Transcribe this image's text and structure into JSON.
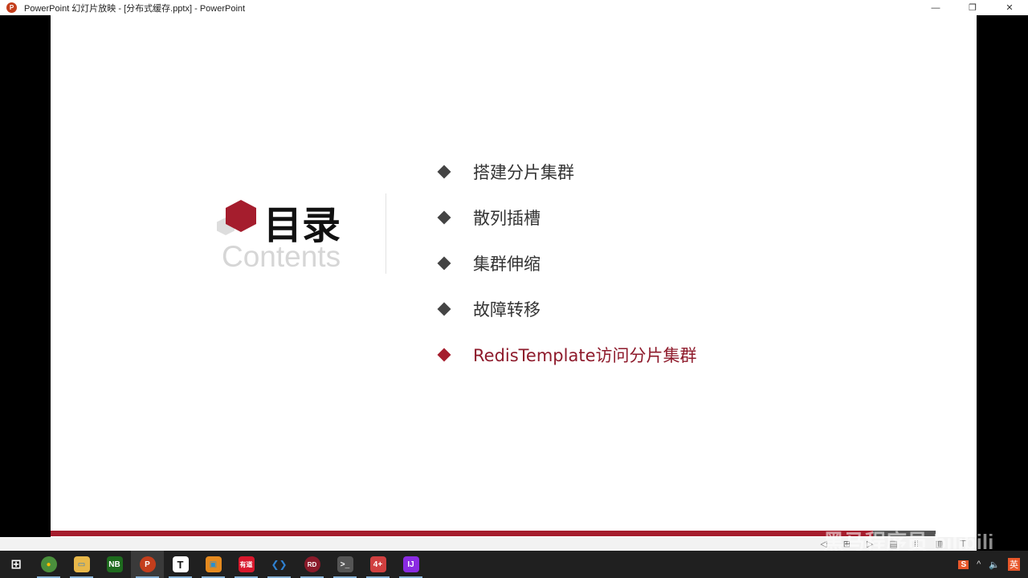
{
  "window": {
    "title": "PowerPoint 幻灯片放映 - [分布式缓存.pptx] - PowerPoint",
    "minimize": "—",
    "restore": "❐",
    "close": "✕"
  },
  "slide": {
    "title": "目录",
    "subtitle": "Contents",
    "items": [
      {
        "label": "搭建分片集群",
        "active": false
      },
      {
        "label": "散列插槽",
        "active": false
      },
      {
        "label": "集群伸缩",
        "active": false
      },
      {
        "label": "故障转移",
        "active": false
      },
      {
        "label": "RedisTemplate访问分片集群",
        "active": true
      }
    ],
    "accent": "#a51d2d"
  },
  "slideshow_toolbar": [
    "◁",
    "⊞",
    "▷",
    "▤",
    "⁞⁞",
    "▥",
    "⊤"
  ],
  "watermark": "黑马程序员 bilibili",
  "taskbar": {
    "apps": [
      {
        "name": "windows-start",
        "glyph": "⊞",
        "color": "transparent"
      },
      {
        "name": "chrome",
        "glyph": "●",
        "color": "#4a8f3c"
      },
      {
        "name": "file-explorer",
        "glyph": "▭",
        "color": "#e8b84a"
      },
      {
        "name": "notepad-nb",
        "glyph": "NB",
        "color": "#1e6b1e"
      },
      {
        "name": "powerpoint",
        "glyph": "P",
        "color": "#c43e1c"
      },
      {
        "name": "typora",
        "glyph": "T",
        "color": "#ffffff"
      },
      {
        "name": "vmware",
        "glyph": "▣",
        "color": "#e58a1f"
      },
      {
        "name": "youdao",
        "glyph": "有道",
        "color": "#d8182c"
      },
      {
        "name": "vscode",
        "glyph": "❮❯",
        "color": "#2f80d0"
      },
      {
        "name": "redis-desktop",
        "glyph": "RD",
        "color": "#8a1a2a"
      },
      {
        "name": "terminal",
        "glyph": ">_",
        "color": "#555555"
      },
      {
        "name": "app-4plus",
        "glyph": "4+",
        "color": "#d04040"
      },
      {
        "name": "intellij",
        "glyph": "IJ",
        "color": "#8a2be2"
      }
    ],
    "tray": {
      "sogou": "S",
      "chevron": "^",
      "volume": "🔈",
      "ime": "英"
    }
  }
}
